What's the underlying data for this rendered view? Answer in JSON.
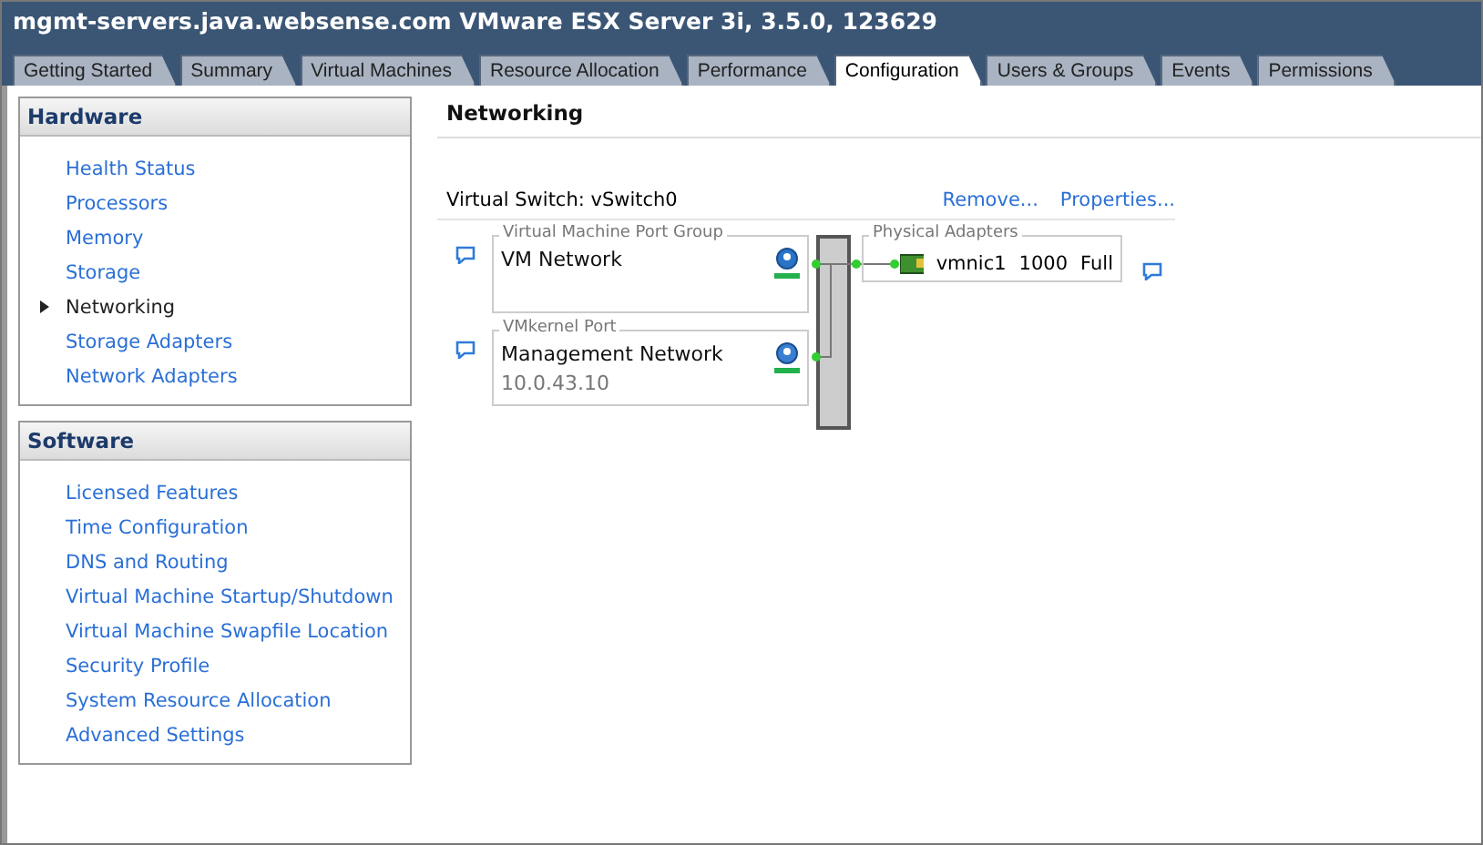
{
  "window": {
    "title": "mgmt-servers.java.websense.com VMware ESX Server 3i, 3.5.0, 123629"
  },
  "tabs": [
    {
      "label": "Getting Started",
      "selected": false
    },
    {
      "label": "Summary",
      "selected": false
    },
    {
      "label": "Virtual Machines",
      "selected": false
    },
    {
      "label": "Resource Allocation",
      "selected": false
    },
    {
      "label": "Performance",
      "selected": false
    },
    {
      "label": "Configuration",
      "selected": true
    },
    {
      "label": "Users & Groups",
      "selected": false
    },
    {
      "label": "Events",
      "selected": false
    },
    {
      "label": "Permissions",
      "selected": false
    }
  ],
  "sidebar": [
    {
      "title": "Hardware",
      "items": [
        {
          "label": "Health Status",
          "selected": false
        },
        {
          "label": "Processors",
          "selected": false
        },
        {
          "label": "Memory",
          "selected": false
        },
        {
          "label": "Storage",
          "selected": false
        },
        {
          "label": "Networking",
          "selected": true
        },
        {
          "label": "Storage Adapters",
          "selected": false
        },
        {
          "label": "Network Adapters",
          "selected": false
        }
      ]
    },
    {
      "title": "Software",
      "items": [
        {
          "label": "Licensed Features",
          "selected": false
        },
        {
          "label": "Time Configuration",
          "selected": false
        },
        {
          "label": "DNS and Routing",
          "selected": false
        },
        {
          "label": "Virtual Machine Startup/Shutdown",
          "selected": false
        },
        {
          "label": "Virtual Machine Swapfile Location",
          "selected": false
        },
        {
          "label": "Security Profile",
          "selected": false
        },
        {
          "label": "System Resource Allocation",
          "selected": false
        },
        {
          "label": "Advanced Settings",
          "selected": false
        }
      ]
    }
  ],
  "content": {
    "heading": "Networking",
    "switch_label": "Virtual Switch: vSwitch0",
    "actions": [
      "Remove...",
      "Properties..."
    ],
    "port_groups": [
      {
        "kind": "vm",
        "type_label": "Virtual Machine Port Group",
        "name": "VM Network"
      },
      {
        "kind": "vmkernel",
        "type_label": "VMkernel Port",
        "name": "Management Network",
        "address": "10.0.43.10"
      }
    ],
    "physical": {
      "type_label": "Physical Adapters",
      "adapter": "vmnic1",
      "speed": "1000",
      "duplex": "Full"
    }
  }
}
